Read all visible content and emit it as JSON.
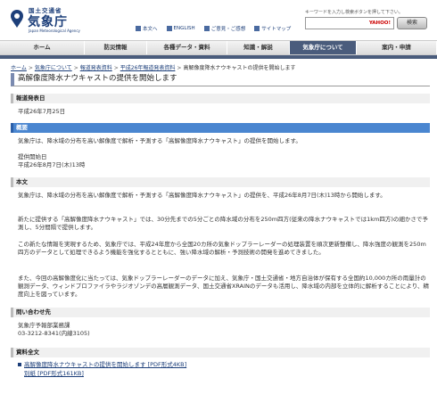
{
  "header": {
    "logo_small": "国土交通省",
    "logo_main": "気象庁",
    "logo_english": "Japan Meteorological Agency",
    "links": [
      "本文へ",
      "ENGLISH",
      "ご意見・ご感想",
      "サイトマップ"
    ],
    "search_note": "キーワードを入力し検索ボタンを押して下さい。",
    "search_brand": "YAHOO!",
    "search_button": "検索"
  },
  "nav": {
    "items": [
      "ホーム",
      "防災情報",
      "各種データ・資料",
      "知識・解説",
      "気象庁について",
      "案内・申請"
    ],
    "active_index": 4
  },
  "breadcrumb": [
    "ホーム",
    "気象庁について",
    "報道発表資料",
    "平成26年報道発表資料",
    "高解像度降水ナウキャストの提供を開始します"
  ],
  "page": {
    "title": "高解像度降水ナウキャストの提供を開始します",
    "date_heading": "報道発表日",
    "date_text": "平成26年7月25日",
    "summary_heading": "概要",
    "summary_text": "気象庁は、降水域の分布を高い解像度で解析・予測する「高解像度降水ナウキャスト」の提供を開始します。",
    "start_label": "提供開始日",
    "start_date": "平成26年8月7日(木)13時",
    "body_heading": "本文",
    "body_p1": "気象庁は、降水域の分布を高い解像度で解析・予測する「高解像度降水ナウキャスト」の提供を、平成26年8月7日(木)13時から開始します。",
    "body_p2": "新たに提供する「高解像度降水ナウキャスト」では、30分先までの5分ごとの降水域の分布を250m四方(従来の降水ナウキャストでは1km四方)の細かさで予測し、5分間隔で提供します。",
    "body_p3": "この新たな情報を実現するため、気象庁では、平成24年度から全国20カ所の気象ドップラーレーダーの処理装置を順次更新整備し、降水強度の観測を250m四方のデータとして処理できるよう機能を強化するとともに、強い降水域の解析・予測技術の開発を進めてきました。",
    "body_p4": "また、今回の高解像度化に当たっては、気象ドップラーレーダーのデータに加え、気象庁・国土交通省・地方自治体が保有する全国約10,000カ所の雨量計の観測データ、ウィンドプロファイラやラジオゾンデの高層観測データ、国土交通省XRAINのデータも活用し、降水域の内部を立体的に解析することにより、精度向上を図っています。",
    "contact_heading": "問い合わせ先",
    "contact_name": "気象庁予報部業務課",
    "contact_tel": "03-3212-8341(内線3105)",
    "materials_heading": "資料全文",
    "material1": "高解像度降水ナウキャストの提供を開始します [PDF形式4KB]",
    "material2": "別紙 [PDF形式161KB]"
  }
}
